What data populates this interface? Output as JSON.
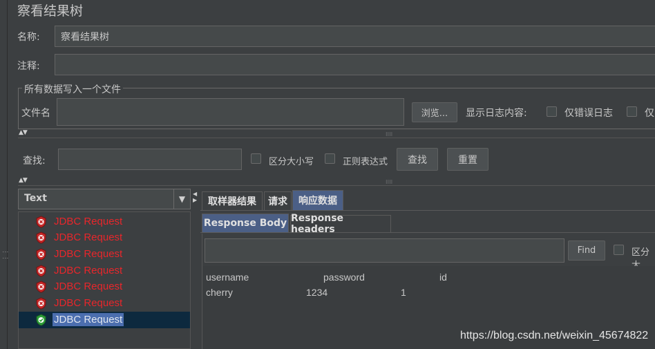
{
  "panel": {
    "title": "察看结果树"
  },
  "name_field": {
    "label": "名称:",
    "value": "察看结果树"
  },
  "comment_field": {
    "label": "注释:",
    "value": ""
  },
  "file_group": {
    "title": "所有数据写入一个文件",
    "filename_label": "文件名",
    "filename_value": "",
    "browse_label": "浏览...",
    "log_label": "显示日志内容:",
    "errors_only_label": "仅错误日志",
    "success_only_label": "仅"
  },
  "search": {
    "label": "查找:",
    "value": "",
    "case_label": "区分大小写",
    "regex_label": "正则表达式",
    "find_label": "查找",
    "reset_label": "重置"
  },
  "renderer": {
    "selected": "Text"
  },
  "tree": {
    "items": [
      {
        "label": "JDBC Request",
        "status": "error",
        "icon": "error-shield-icon"
      },
      {
        "label": "JDBC Request",
        "status": "error",
        "icon": "error-shield-icon"
      },
      {
        "label": "JDBC Request",
        "status": "error",
        "icon": "error-shield-icon"
      },
      {
        "label": "JDBC Request",
        "status": "error",
        "icon": "error-shield-icon"
      },
      {
        "label": "JDBC Request",
        "status": "error",
        "icon": "error-shield-icon"
      },
      {
        "label": "JDBC Request",
        "status": "error",
        "icon": "error-shield-icon"
      },
      {
        "label": "JDBC Request",
        "status": "success",
        "icon": "success-shield-icon",
        "selected": true
      }
    ]
  },
  "result_tabs": {
    "sampler": "取样器结果",
    "request": "请求",
    "response": "响应数据"
  },
  "response_tabs": {
    "body": "Response Body",
    "headers": "Response headers"
  },
  "response_search": {
    "value": "",
    "find_label": "Find",
    "case_label": "区分大"
  },
  "response_body": {
    "header": [
      "username",
      "password",
      "id"
    ],
    "row": [
      "cherry",
      "1234",
      "1"
    ]
  },
  "watermark": "https://blog.csdn.net/weixin_45674822",
  "colors": {
    "error": "#e8262b",
    "success": "#4caf50",
    "selected_row": "#0d293e",
    "active_tab": "#4b6eaf"
  }
}
